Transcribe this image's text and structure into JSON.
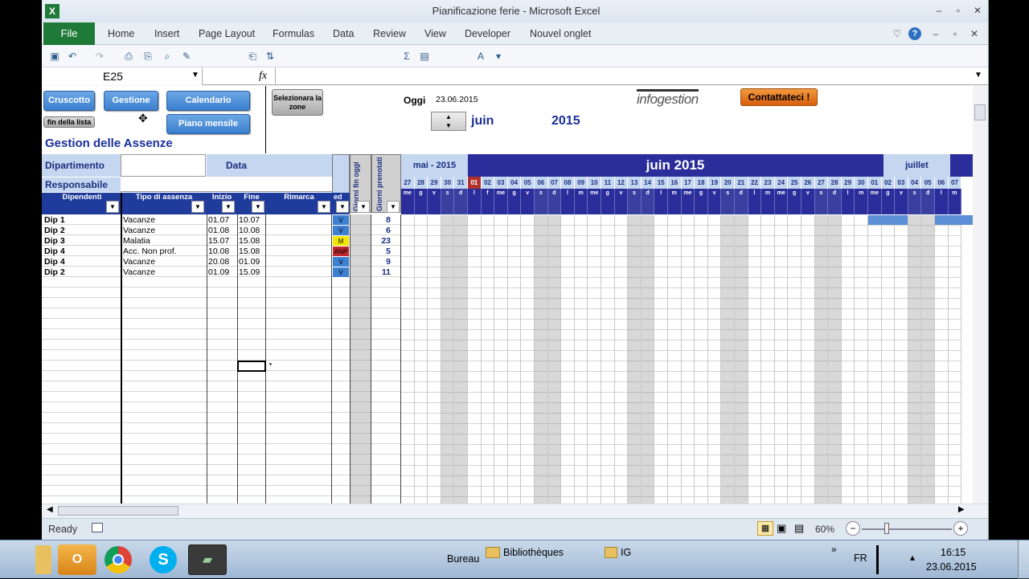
{
  "window": {
    "title": "Pianificazione ferie  -  Microsoft Excel"
  },
  "ribbon": {
    "file": "File",
    "tabs": [
      "Home",
      "Insert",
      "Page Layout",
      "Formulas",
      "Data",
      "Review",
      "View",
      "Developer",
      "Nouvel onglet"
    ]
  },
  "formula_bar": {
    "name_box": "E25",
    "fx": "fx",
    "value": ""
  },
  "buttons": {
    "cruscotto": "Cruscotto",
    "gestione": "Gestione",
    "calendario": "Calendario",
    "piano": "Piano mensile",
    "fin_lista": "fin della lista",
    "selezionare": "Selezionara la zone",
    "contatti": "Contattateci !"
  },
  "header": {
    "oggi_label": "Oggi",
    "oggi_value": "23.06.2015",
    "month": "juin",
    "year": "2015",
    "logo": "infogestion",
    "sheet_title": "Gestion delle Assenze"
  },
  "form": {
    "dipartimento": "Dipartimento",
    "data": "Data",
    "responsabile": "Responsabile"
  },
  "columns": [
    "Dipendenti",
    "Tipo di assenza",
    "Inizio",
    "Fine",
    "Rimarca",
    "ed",
    "Giorni fin oggi",
    "Giorni prenotati"
  ],
  "rows": [
    {
      "dip": "Dip 1",
      "tipo": "Vacanze",
      "inizio": "01.07",
      "fine": "10.07",
      "code": "V",
      "code_color": "#3d7fd1",
      "giorni": "8"
    },
    {
      "dip": "Dip 2",
      "tipo": "Vacanze",
      "inizio": "01.08",
      "fine": "10.08",
      "code": "V",
      "code_color": "#3d7fd1",
      "giorni": "6"
    },
    {
      "dip": "Dip 3",
      "tipo": "Malatia",
      "inizio": "15.07",
      "fine": "15.08",
      "code": "M",
      "code_color": "#f2e600",
      "giorni": "23"
    },
    {
      "dip": "Dip 4",
      "tipo": "Acc. Non prof.",
      "inizio": "10.08",
      "fine": "15.08",
      "code": "ANP",
      "code_color": "#c0282e",
      "giorni": "5"
    },
    {
      "dip": "Dip 4",
      "tipo": "Vacanze",
      "inizio": "20.08",
      "fine": "01.09",
      "code": "V",
      "code_color": "#3d7fd1",
      "giorni": "9"
    },
    {
      "dip": "Dip 2",
      "tipo": "Vacanze",
      "inizio": "01.09",
      "fine": "15.09",
      "code": "V",
      "code_color": "#3d7fd1",
      "giorni": "11"
    }
  ],
  "calendar": {
    "prev_month": "mai - 2015",
    "month": "juin 2015",
    "next_month": "juillet",
    "days": [
      "27",
      "28",
      "29",
      "30",
      "31",
      "01",
      "02",
      "03",
      "04",
      "05",
      "06",
      "07",
      "08",
      "09",
      "10",
      "11",
      "12",
      "13",
      "14",
      "15",
      "16",
      "17",
      "18",
      "19",
      "20",
      "21",
      "22",
      "23",
      "24",
      "25",
      "26",
      "27",
      "28",
      "29",
      "30",
      "01",
      "02",
      "03",
      "04",
      "05",
      "06",
      "07"
    ],
    "weekdays": [
      "me",
      "g",
      "v",
      "s",
      "d",
      "l",
      "f",
      "me",
      "g",
      "v",
      "s",
      "d",
      "l",
      "m",
      "me",
      "g",
      "v",
      "s",
      "d",
      "l",
      "m",
      "me",
      "g",
      "v",
      "s",
      "d",
      "l",
      "m",
      "me",
      "g",
      "v",
      "s",
      "d",
      "l",
      "m",
      "me",
      "g",
      "v",
      "s",
      "d",
      "l",
      "m"
    ],
    "today_index": 5
  },
  "status": {
    "ready": "Ready",
    "zoom": "60%"
  },
  "taskbar": {
    "bureau": "Bureau",
    "biblio": "Bibliothèques",
    "ig": "IG",
    "lang": "FR",
    "time": "16:15",
    "date": "23.06.2015"
  }
}
